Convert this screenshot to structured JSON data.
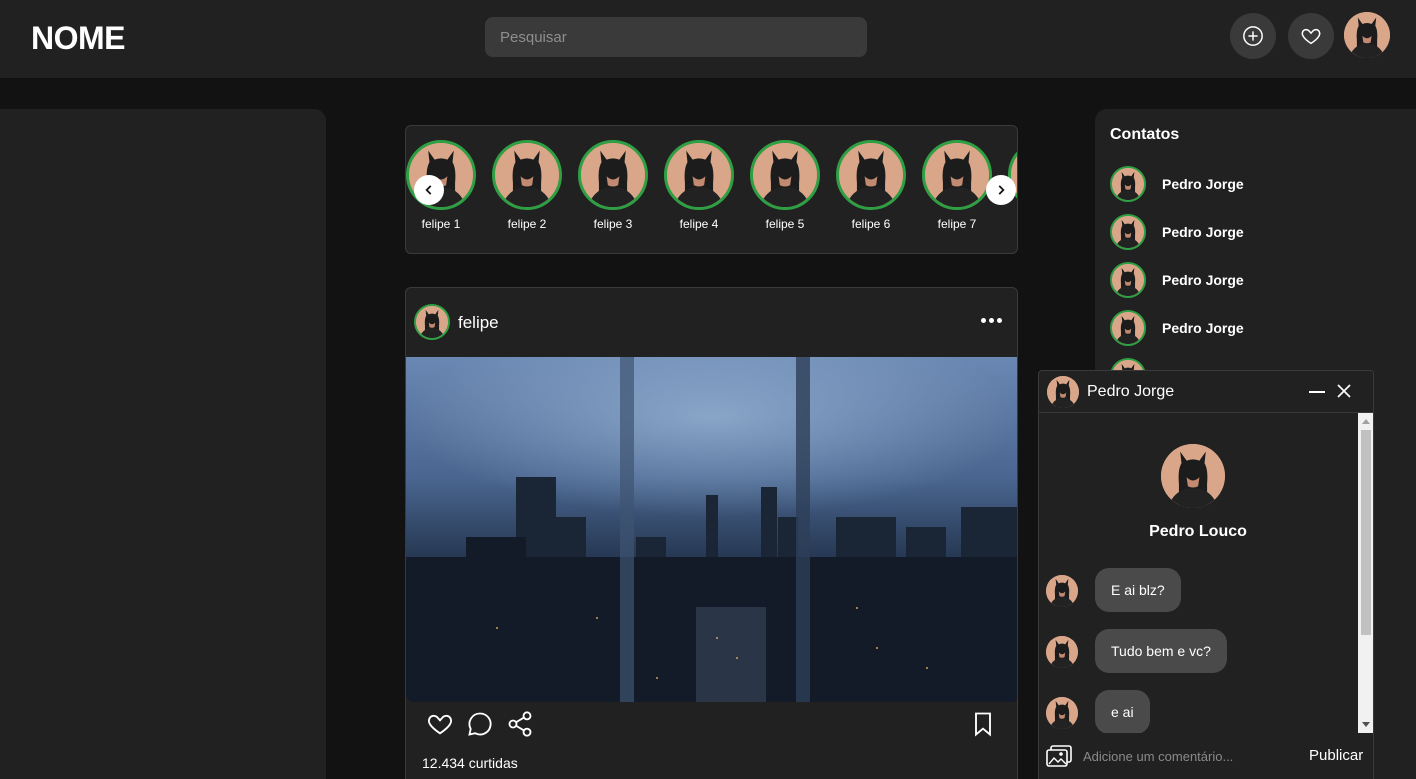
{
  "header": {
    "logo": "NOME",
    "search_placeholder": "Pesquisar"
  },
  "stories": {
    "items": [
      {
        "name": "felipe 1"
      },
      {
        "name": "felipe 2"
      },
      {
        "name": "felipe 3"
      },
      {
        "name": "felipe 4"
      },
      {
        "name": "felipe 5"
      },
      {
        "name": "felipe 6"
      },
      {
        "name": "felipe 7"
      }
    ]
  },
  "post": {
    "username": "felipe",
    "likes": "12.434 curtidas"
  },
  "contacts": {
    "title": "Contatos",
    "items": [
      {
        "name": "Pedro Jorge"
      },
      {
        "name": "Pedro Jorge"
      },
      {
        "name": "Pedro Jorge"
      },
      {
        "name": "Pedro Jorge"
      }
    ]
  },
  "chat": {
    "title": "Pedro Jorge",
    "profile_name": "Pedro Louco",
    "messages": [
      {
        "text": "E ai blz?"
      },
      {
        "text": "Tudo bem e vc?"
      },
      {
        "text": "e ai"
      }
    ],
    "comment_placeholder": "Adicione um comentário...",
    "publish_label": "Publicar"
  },
  "colors": {
    "accent_ring": "#2ea043",
    "panel": "#212121",
    "background": "#121212"
  }
}
